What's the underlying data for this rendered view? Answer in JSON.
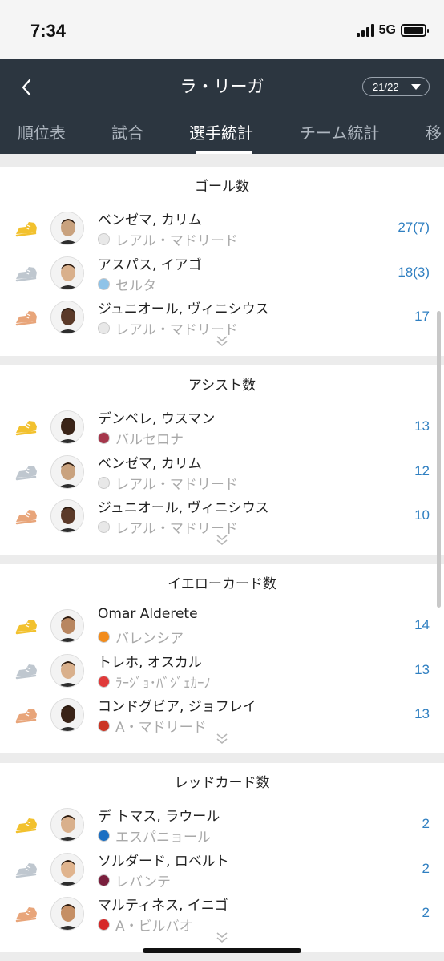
{
  "status": {
    "time": "7:34",
    "network": "5G"
  },
  "header": {
    "title": "ラ・リーガ",
    "season": "21/22"
  },
  "tabs": [
    "順位表",
    "試合",
    "選手統計",
    "チーム統計",
    "移"
  ],
  "colors": {
    "header_bg": "#2c3640",
    "value": "#2f7fc1",
    "gold": "#f2c12e",
    "silver": "#bfc7cf",
    "bronze": "#e8a57a"
  },
  "sections": [
    {
      "title": "ゴール数",
      "rows": [
        {
          "name": "ベンゼマ, カリム",
          "team": "レアル・マドリード",
          "value": "27(7)",
          "rank": "gold",
          "crest": "real-madrid"
        },
        {
          "name": "アスパス, イアゴ",
          "team": "セルタ",
          "value": "18(3)",
          "rank": "silver",
          "crest": "celta"
        },
        {
          "name": "ジュニオール, ヴィニシウス",
          "team": "レアル・マドリード",
          "value": "17",
          "rank": "bronze",
          "crest": "real-madrid"
        }
      ]
    },
    {
      "title": "アシスト数",
      "rows": [
        {
          "name": "デンベレ, ウスマン",
          "team": "バルセロナ",
          "value": "13",
          "rank": "gold",
          "crest": "barcelona"
        },
        {
          "name": "ベンゼマ, カリム",
          "team": "レアル・マドリード",
          "value": "12",
          "rank": "silver",
          "crest": "real-madrid"
        },
        {
          "name": "ジュニオール, ヴィニシウス",
          "team": "レアル・マドリード",
          "value": "10",
          "rank": "bronze",
          "crest": "real-madrid"
        }
      ]
    },
    {
      "title": "イエローカード数",
      "rows": [
        {
          "name": "Omar Alderete",
          "team": "バレンシア",
          "value": "14",
          "rank": "gold",
          "crest": "valencia"
        },
        {
          "name": "トレホ, オスカル",
          "team": "ﾗｰｼﾞｮ･ﾊﾞｼﾞｪｶｰﾉ",
          "value": "13",
          "rank": "silver",
          "crest": "rayo"
        },
        {
          "name": "コンドグビア, ジョフレイ",
          "team": "A・マドリード",
          "value": "13",
          "rank": "bronze",
          "crest": "atletico"
        }
      ]
    },
    {
      "title": "レッドカード数",
      "rows": [
        {
          "name": "デ トマス, ラウール",
          "team": "エスパニョール",
          "value": "2",
          "rank": "gold",
          "crest": "espanyol"
        },
        {
          "name": "ソルダード, ロベルト",
          "team": "レバンテ",
          "value": "2",
          "rank": "silver",
          "crest": "levante"
        },
        {
          "name": "マルティネス, イニゴ",
          "team": "A・ビルバオ",
          "value": "2",
          "rank": "bronze",
          "crest": "bilbao"
        }
      ]
    }
  ]
}
